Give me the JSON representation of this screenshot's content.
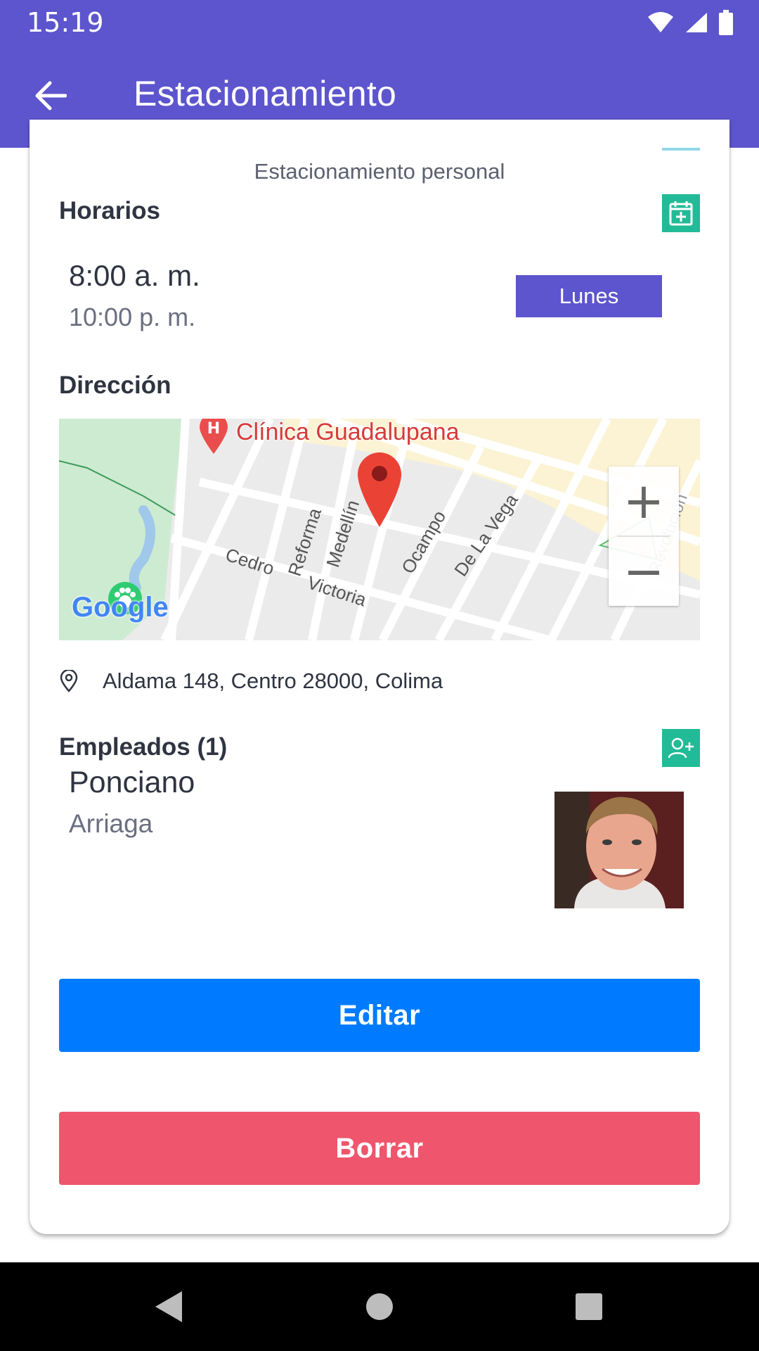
{
  "status_bar": {
    "time": "15:19"
  },
  "app_bar": {
    "title": "Estacionamiento"
  },
  "parking": {
    "subtitle": "Estacionamiento personal",
    "schedule_title": "Horarios",
    "open_time": "8:00 a. m.",
    "close_time": "10:00 p. m.",
    "day": "Lunes",
    "address_title": "Dirección",
    "address": "Aldama 148, Centro 28000, Colima"
  },
  "map": {
    "place_label": "Clínica Guadalupana",
    "streets": [
      "Cedro",
      "Reforma",
      "Medellín",
      "Victoria",
      "Ocampo",
      "De La Vega",
      "Revolución"
    ],
    "zoom_in": "+",
    "zoom_out": "−",
    "logo": "Google"
  },
  "employees": {
    "title": "Empleados (1)",
    "items": [
      {
        "first_name": "Ponciano",
        "last_name": "Arriaga"
      }
    ]
  },
  "actions": {
    "edit": "Editar",
    "delete": "Borrar"
  },
  "colors": {
    "primary": "#5d55cd",
    "accent_green": "#22bb97",
    "edit_blue": "#007bff",
    "delete_red": "#ef556c"
  },
  "icons": {
    "back": "arrow-left-icon",
    "schedule_add": "calendar-plus-icon",
    "address": "location-pin-icon",
    "employee_add": "person-add-icon",
    "marker": "map-marker-icon"
  }
}
